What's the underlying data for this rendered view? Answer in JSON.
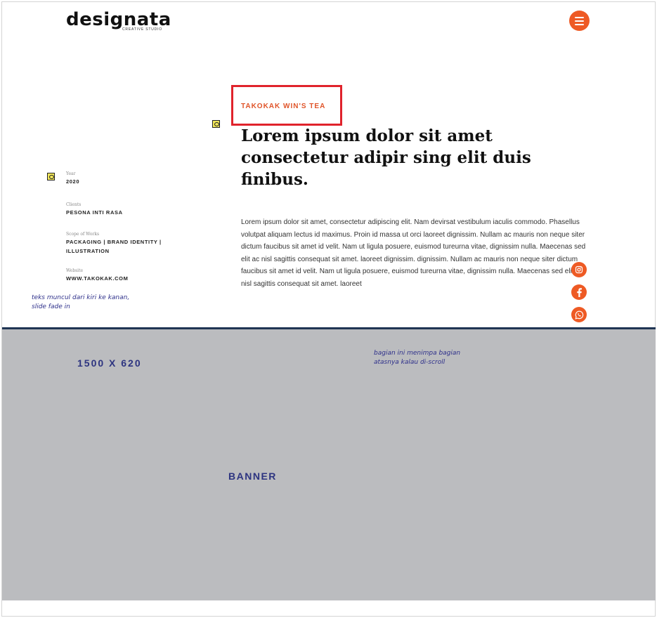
{
  "header": {
    "logo_text": "designata",
    "logo_subtext": "CREATIVE STUDIO",
    "menu_icon": "hamburger-menu-icon"
  },
  "project": {
    "name": "TAKOKAK WIN'S TEA",
    "headline": "Lorem ipsum dolor sit amet consectetur adipir sing elit duis finibus.",
    "body": "Lorem ipsum dolor sit amet, consectetur adipiscing elit. Nam devirsat vestibulum iaculis commodo. Phasellus volutpat aliquam lectus id maximus. Proin id massa ut orci laoreet dignissim. Nullam ac mauris non neque siter dictum faucibus sit amet id velit. Nam ut ligula posuere, euismod tureurna vitae, dignissim nulla. Maecenas sed elit ac nisl sagittis consequat sit amet. laoreet dignissim. dignissim. Nullam ac mauris non neque siter dictum faucibus sit amet id velit. Nam ut ligula posuere, euismod tureurna vitae, dignissim nulla. Maecenas sed elit ac nisl sagittis consequat sit amet. laoreet"
  },
  "meta": {
    "year_label": "Year",
    "year_value": "2020",
    "clients_label": "Clients",
    "clients_value": "PESONA INTI RASA",
    "scope_label": "Scope of Works",
    "scope_value": "PACKAGING | BRAND IDENTITY | ILLUSTRATION",
    "website_label": "Website",
    "website_value": "WWW.TAKOKAK.COM"
  },
  "annotations": {
    "left_note": "teks muncul dari kiri ke kanan, slide fade in",
    "banner_note": "bagian ini menimpa bagian atasnya kalau di-scroll"
  },
  "social": {
    "items": [
      "instagram-icon",
      "facebook-icon",
      "whatsapp-icon"
    ]
  },
  "banner": {
    "size": "1500 X 620",
    "label": "BANNER"
  },
  "colors": {
    "accent": "#ee5a24",
    "highlight_box": "#e0232c",
    "banner_bg": "#bbbcbf",
    "annotation_text": "#2d2f8a",
    "banner_text": "#2d3480"
  }
}
